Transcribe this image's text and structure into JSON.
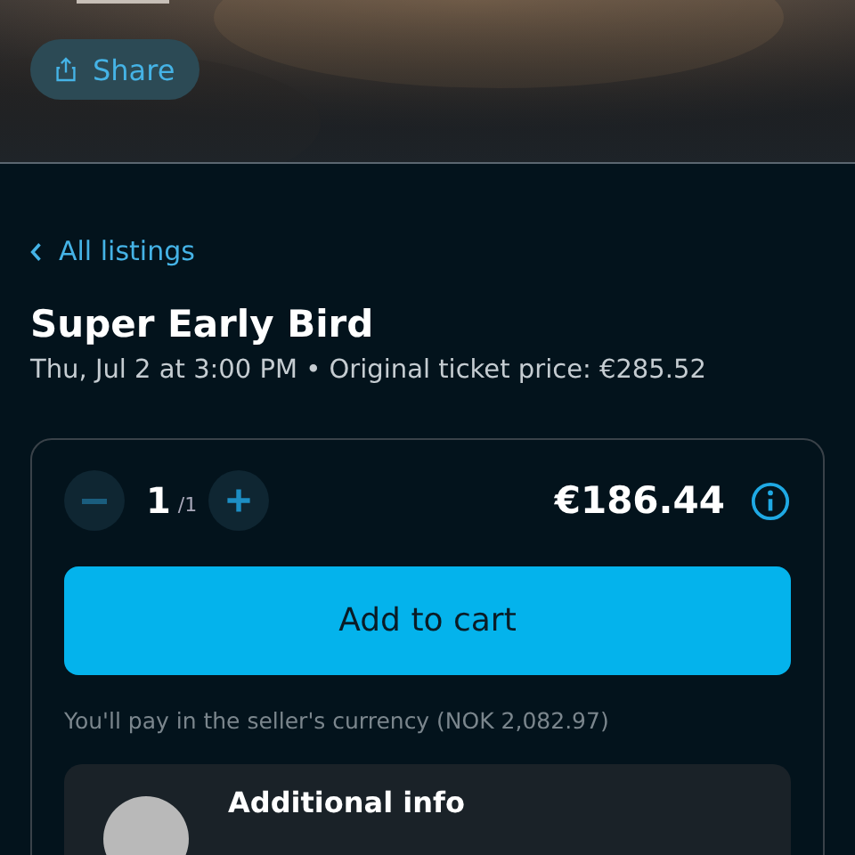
{
  "header": {
    "share_button": "Share"
  },
  "back_link": "All listings",
  "listing": {
    "title": "Super Early Bird",
    "subtitle": "Thu, Jul 2 at 3:00 PM • Original ticket price: €285.52"
  },
  "purchase": {
    "quantity": "1",
    "max": "/1",
    "minus_disabled": true,
    "price": "€186.44",
    "button": "Add to cart",
    "currency_note": "You'll pay in the seller's currency (NOK 2,082.97)"
  },
  "additional": {
    "title": "Additional info"
  }
}
